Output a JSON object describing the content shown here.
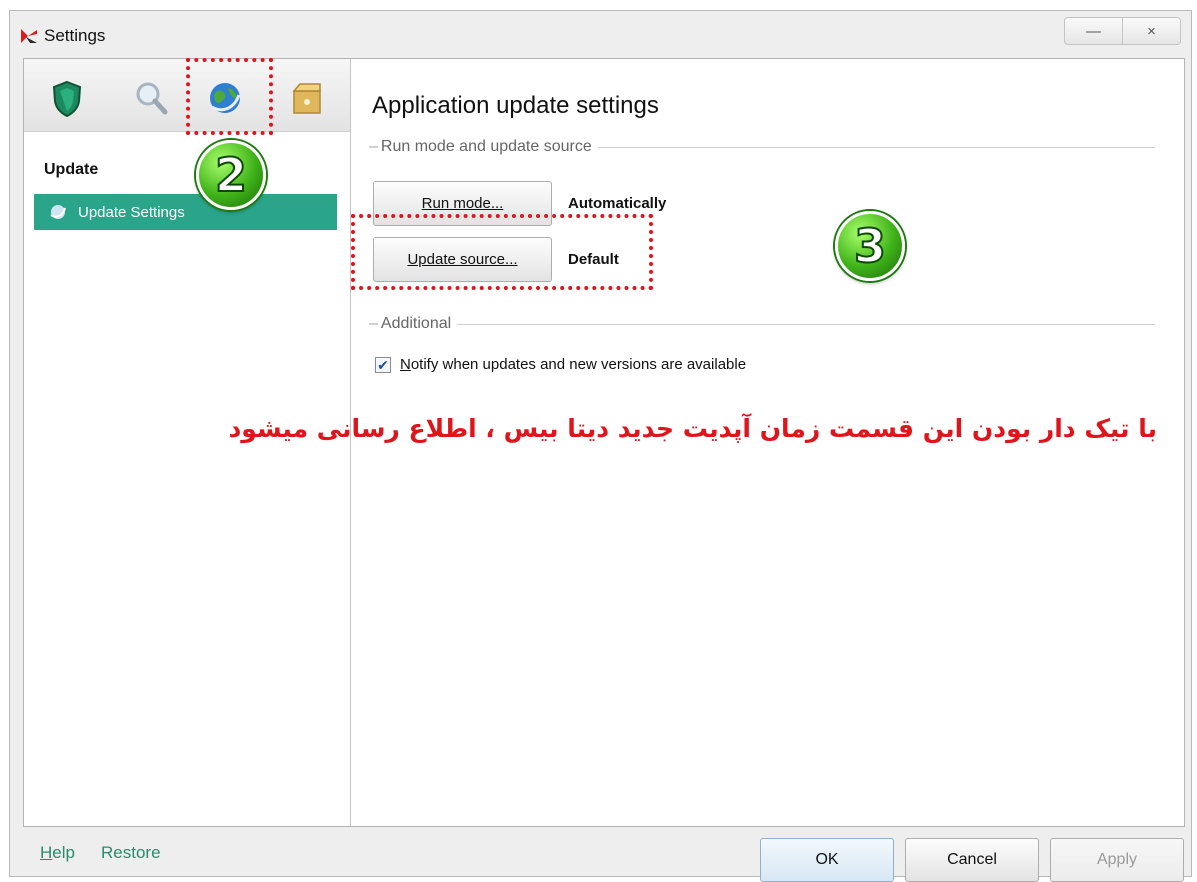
{
  "window": {
    "title": "Settings",
    "minimize_symbol": "—",
    "close_symbol": "×"
  },
  "tabs": [
    {
      "name": "protection-tab",
      "icon": "shield-icon"
    },
    {
      "name": "scan-tab",
      "icon": "magnifier-icon"
    },
    {
      "name": "update-tab",
      "icon": "globe-icon",
      "selected": true
    },
    {
      "name": "advanced-tab",
      "icon": "box-icon"
    }
  ],
  "sidebar": {
    "section_title": "Update",
    "items": [
      {
        "label": "Update Settings",
        "icon": "update-globe-icon",
        "selected": true
      }
    ]
  },
  "main": {
    "title": "Application update settings",
    "group1_label": "Run mode and update source",
    "run_mode_button": "Run mode...",
    "run_mode_value": "Automatically",
    "update_source_button": "Update source...",
    "update_source_value": "Default",
    "group2_label": "Additional",
    "notify_checkbox": {
      "checked": true,
      "label_underlined": "N",
      "label_rest": "otify when updates and new versions are available"
    }
  },
  "annotations": {
    "badge_2": "2",
    "badge_3": "3",
    "note": "با تیک دار بودن این قسمت زمان آپدیت جدید دیتا بیس ، اطلاع رسانی میشود",
    "color": "#e0151b"
  },
  "footer": {
    "help_underlined": "H",
    "help_rest": "elp",
    "restore": "Restore",
    "ok": "OK",
    "cancel": "Cancel",
    "apply": "Apply"
  },
  "colors": {
    "accent": "#2aa589",
    "link": "#2a8c6d"
  }
}
